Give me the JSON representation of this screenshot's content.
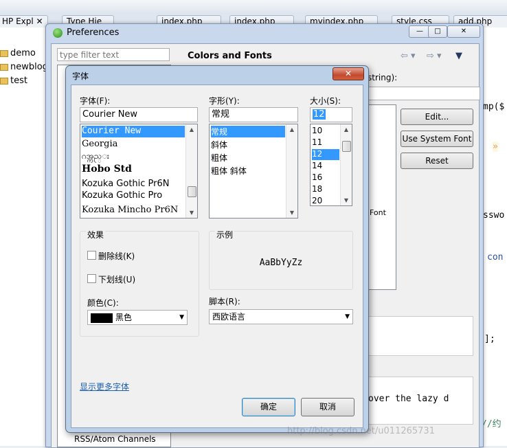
{
  "ide": {
    "tabs": [
      "HP Expl",
      "Type Hie",
      "index.php",
      "index.php",
      "myindex.php",
      "style.css",
      "add.php"
    ],
    "explorer_items": [
      "demo",
      "newblog",
      "test"
    ],
    "code_fragments": [
      "mp($",
      "»",
      "sswo",
      "con",
      "];",
      "//约"
    ],
    "watermark": "http://blog.csdn.net/u011265731"
  },
  "prefs": {
    "title": "Preferences",
    "filter_placeholder": "type filter text",
    "heading": "Colors and Fonts",
    "color_label": "string):",
    "buttons": {
      "edit": "Edit...",
      "system_font": "Use System Font",
      "reset": "Reset"
    },
    "tree_visible_item": "RSS/Atom Channels",
    "partial_font_label": "Font",
    "preview_text": "over the lazy d"
  },
  "font_dialog": {
    "title": "字体",
    "close": "✕",
    "font_label": "字体(F):",
    "font_value": "Courier New",
    "font_list": [
      "Courier New",
      "Georgia",
      "ဂအ္ကည္း",
      "Hobo Std",
      "Kozuka Gothic Pr6N",
      "Kozuka Gothic Pro",
      "Kozuka Mincho Pr6N"
    ],
    "font_selected_index": 0,
    "style_label": "字形(Y):",
    "style_value": "常规",
    "style_list": [
      "常规",
      "斜体",
      "粗体",
      "粗体 斜体"
    ],
    "style_selected_index": 0,
    "size_label": "大小(S):",
    "size_value": "12",
    "size_list": [
      "10",
      "11",
      "12",
      "14",
      "16",
      "18",
      "20"
    ],
    "size_selected_index": 2,
    "effects_label": "效果",
    "strikeout_label": "删除线(K)",
    "underline_label": "下划线(U)",
    "color_label": "颜色(C):",
    "color_value": "黑色",
    "color_swatch": "#000000",
    "sample_label": "示例",
    "sample_text": "AaBbYyZz",
    "script_label": "脚本(R):",
    "script_value": "西欧语言",
    "more_fonts": "显示更多字体",
    "ok": "确定",
    "cancel": "取消"
  },
  "colors": {
    "accent": "#3399ff",
    "link": "#1a5fb4",
    "close": "#c24a2f"
  }
}
